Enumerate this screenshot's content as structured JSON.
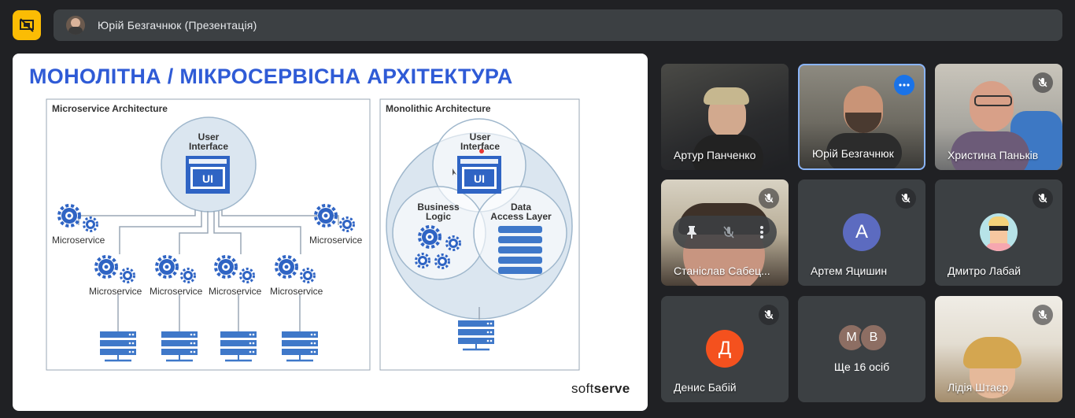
{
  "presenter_bar": {
    "label": "Юрій Безгачнюк (Презентація)"
  },
  "slide": {
    "title": "МОНОЛІТНА / МІКРОСЕРВІСНА АРХІТЕКТУРА",
    "brand_soft": "soft",
    "brand_serve": "serve",
    "left_diagram": {
      "title": "Microservice Architecture",
      "ui_label_1": "User",
      "ui_label_2": "Interface",
      "ui_box": "UI",
      "microservice_label": "Microservice"
    },
    "right_diagram": {
      "title": "Monolithic Architecture",
      "ui_label_1": "User",
      "ui_label_2": "Interface",
      "ui_box": "UI",
      "bl_1": "Business",
      "bl_2": "Logic",
      "dal_1": "Data",
      "dal_2": "Access Layer"
    }
  },
  "participants": [
    {
      "name": "Артур Панченко",
      "muted": false
    },
    {
      "name": "Юрій Безгачнюк",
      "muted": false,
      "active_speaker": true
    },
    {
      "name": "Христина Паньків",
      "muted": true
    },
    {
      "name": "Станіслав Сабец...",
      "muted": true
    },
    {
      "name": "Артем Яцишин",
      "muted": true,
      "avatar_letter": "А",
      "avatar_color": "#5c6bc0"
    },
    {
      "name": "Дмитро Лабай",
      "muted": true
    },
    {
      "name": "Денис Бабій",
      "muted": true,
      "avatar_letter": "Д",
      "avatar_color": "#f4511e"
    },
    {
      "name": "Лідія Штаєр",
      "muted": true
    }
  ],
  "more_tile": {
    "label": "Ще 16 осіб",
    "letters": [
      "М",
      "В"
    ]
  },
  "colors": {
    "background": "#202124",
    "tile": "#3c4043",
    "accent_yellow": "#fbbc04",
    "active_blue": "#8ab4f8",
    "slide_title_blue": "#2f5bd6"
  }
}
